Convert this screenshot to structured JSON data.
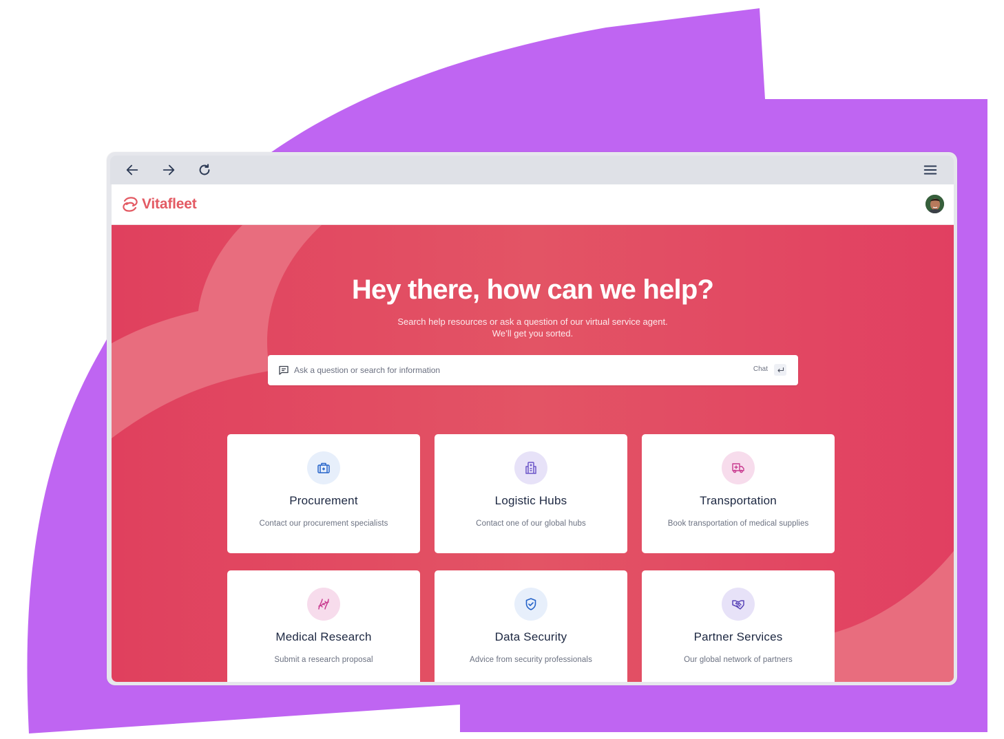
{
  "colors": {
    "backdrop_purple": "#bf65f2",
    "brand": "#e35a63",
    "hero_red": "#e0455f",
    "hero_arc": "#e8707f",
    "toolbar_icon": "#2d3a55"
  },
  "browser": {
    "back_icon": "arrow-left-icon",
    "forward_icon": "arrow-right-icon",
    "reload_icon": "reload-icon",
    "menu_icon": "hamburger-menu-icon"
  },
  "header": {
    "logo_text": "Vitafleet",
    "logo_icon": "vitafleet-logo-icon",
    "avatar_icon": "user-avatar"
  },
  "hero": {
    "title": "Hey there, how can we help?",
    "subtitle_line1": "Search help resources or ask a question of our virtual service agent.",
    "subtitle_line2": "We’ll get you sorted."
  },
  "search": {
    "placeholder": "Ask a question or search for information",
    "value": "",
    "chat_label": "Chat",
    "icon": "chat-message-icon",
    "enter_icon": "enter-key-icon"
  },
  "cards": [
    {
      "title": "Procurement",
      "description": "Contact our procurement specialists",
      "icon": "medical-briefcase-icon",
      "icon_color": "#2563c9",
      "icon_bg": "#e7effb"
    },
    {
      "title": "Logistic Hubs",
      "description": "Contact one of our global hubs",
      "icon": "hospital-building-icon",
      "icon_color": "#6b55c8",
      "icon_bg": "#e7e2f8"
    },
    {
      "title": "Transportation",
      "description": "Book transportation of medical supplies",
      "icon": "ambulance-truck-icon",
      "icon_color": "#c93a8f",
      "icon_bg": "#f7dcec"
    },
    {
      "title": "Medical Research",
      "description": "Submit a research proposal",
      "icon": "dna-icon",
      "icon_color": "#c93a8f",
      "icon_bg": "#f7dcec"
    },
    {
      "title": "Data Security",
      "description": "Advice from security professionals",
      "icon": "shield-check-icon",
      "icon_color": "#2563c9",
      "icon_bg": "#e7effb"
    },
    {
      "title": "Partner Services",
      "description": "Our global network of partners",
      "icon": "handshake-icon",
      "icon_color": "#5a45b8",
      "icon_bg": "#e7e2f8"
    }
  ]
}
